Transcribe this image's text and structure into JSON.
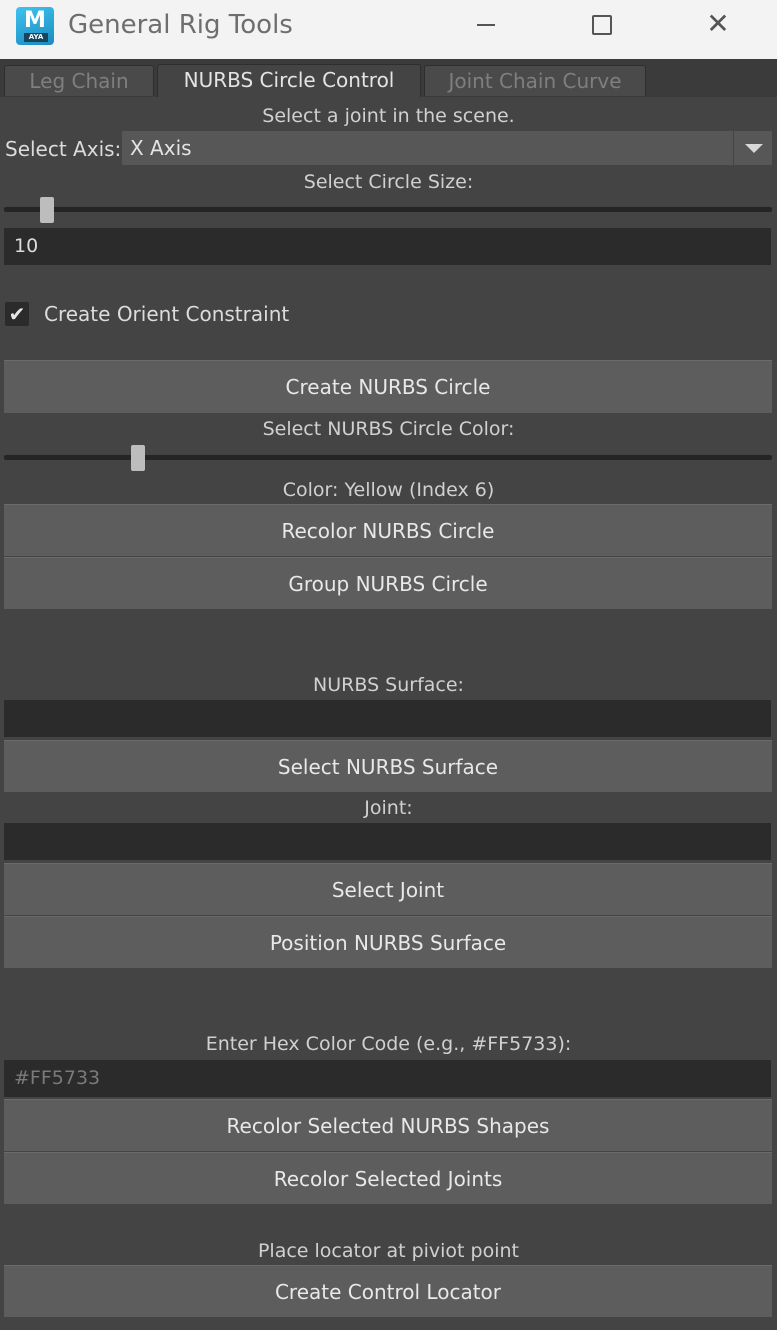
{
  "window": {
    "title": "General Rig Tools",
    "icon_letter": "M",
    "icon_badge": "AYA",
    "close_glyph": "✕"
  },
  "tabs": [
    {
      "label": "Leg Chain",
      "active": false
    },
    {
      "label": "NURBS Circle Control",
      "active": true
    },
    {
      "label": "Joint Chain Curve",
      "active": false
    }
  ],
  "circle": {
    "instruction": "Select a joint in the scene.",
    "axis_label": "Select Axis:",
    "axis_value": "X Axis",
    "size_label": "Select Circle Size:",
    "size_value": "10",
    "orient_checkbox_label": "Create Orient Constraint",
    "orient_checked": true,
    "check_glyph": "✔",
    "create_button": "Create NURBS Circle",
    "color_label": "Select NURBS Circle Color:",
    "color_status": "Color: Yellow (Index 6)",
    "recolor_button": "Recolor NURBS Circle",
    "group_button": "Group NURBS Circle"
  },
  "surface": {
    "surface_label": "NURBS Surface:",
    "surface_value": "",
    "select_surface_button": "Select NURBS Surface",
    "joint_label": "Joint:",
    "joint_value": "",
    "select_joint_button": "Select Joint",
    "position_button": "Position NURBS Surface"
  },
  "hex": {
    "label": "Enter Hex Color Code (e.g., #FF5733):",
    "placeholder": "#FF5733",
    "recolor_shapes_button": "Recolor Selected NURBS Shapes",
    "recolor_joints_button": "Recolor Selected Joints"
  },
  "locator": {
    "label": "Place locator at piviot point",
    "button": "Create Control Locator"
  },
  "colors": {
    "background": "#444444",
    "button": "#5d5d5d",
    "field": "#2b2b2b",
    "titlebar": "#f3f3f3"
  }
}
